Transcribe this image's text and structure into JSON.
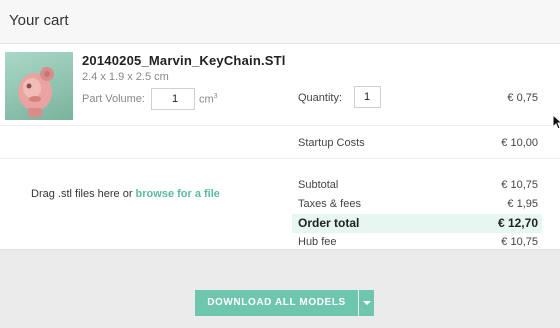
{
  "header": {
    "title": "Your cart"
  },
  "item": {
    "thumbnail_icon": "keychain-model-thumbnail",
    "name": "20140205_Marvin_KeyChain.STl",
    "dimensions": "2.4 x 1.9 x 2.5 cm",
    "volume_label": "Part Volume:",
    "volume_value": "1",
    "volume_unit": "cm",
    "volume_unit_exp": "3",
    "quantity_label": "Quantity:",
    "quantity_value": "1",
    "price": "€ 0,75"
  },
  "startup": {
    "label": "Startup Costs",
    "price": "€ 10,00"
  },
  "dropzone": {
    "text": "Drag .stl files here or ",
    "link": "browse for a file"
  },
  "summary": {
    "subtotal_label": "Subtotal",
    "subtotal_value": "€ 10,75",
    "taxes_label": "Taxes & fees",
    "taxes_value": "€ 1,95",
    "order_total_label": "Order total",
    "order_total_value": "€ 12,70",
    "hub_fee_label": "Hub fee",
    "hub_fee_value": "€ 10,75"
  },
  "footer": {
    "download_label": "DOWNLOAD ALL MODELS",
    "dropdown_icon": "caret-down-icon"
  },
  "colors": {
    "accent": "#6dc6ad",
    "total_highlight": "#e6f6f1",
    "link": "#5bbba0"
  }
}
